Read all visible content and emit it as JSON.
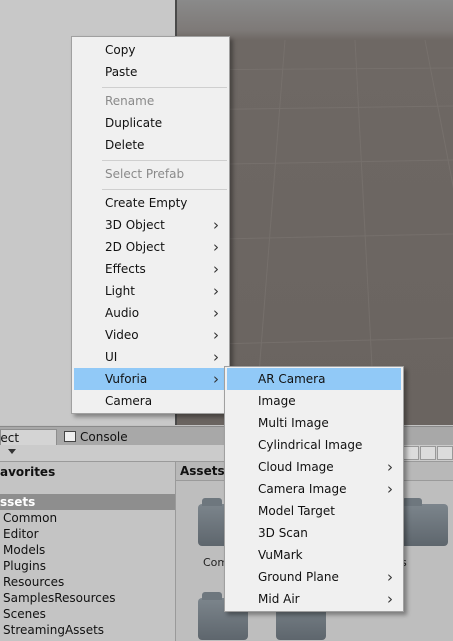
{
  "context_menu": {
    "items": [
      {
        "label": "Copy",
        "enabled": true,
        "submenu": false
      },
      {
        "label": "Paste",
        "enabled": true,
        "submenu": false
      },
      {
        "label": "Rename",
        "enabled": false,
        "submenu": false
      },
      {
        "label": "Duplicate",
        "enabled": true,
        "submenu": false
      },
      {
        "label": "Delete",
        "enabled": true,
        "submenu": false
      },
      {
        "label": "Select Prefab",
        "enabled": false,
        "submenu": false
      },
      {
        "label": "Create Empty",
        "enabled": true,
        "submenu": false
      },
      {
        "label": "3D Object",
        "enabled": true,
        "submenu": true
      },
      {
        "label": "2D Object",
        "enabled": true,
        "submenu": true
      },
      {
        "label": "Effects",
        "enabled": true,
        "submenu": true
      },
      {
        "label": "Light",
        "enabled": true,
        "submenu": true
      },
      {
        "label": "Audio",
        "enabled": true,
        "submenu": true
      },
      {
        "label": "Video",
        "enabled": true,
        "submenu": true
      },
      {
        "label": "UI",
        "enabled": true,
        "submenu": true
      },
      {
        "label": "Vuforia",
        "enabled": true,
        "submenu": true,
        "highlighted": true
      },
      {
        "label": "Camera",
        "enabled": true,
        "submenu": false
      }
    ]
  },
  "submenu": {
    "items": [
      {
        "label": "AR Camera",
        "submenu": false,
        "highlighted": true
      },
      {
        "label": "Image",
        "submenu": false
      },
      {
        "label": "Multi Image",
        "submenu": false
      },
      {
        "label": "Cylindrical Image",
        "submenu": false
      },
      {
        "label": "Cloud Image",
        "submenu": true
      },
      {
        "label": "Camera Image",
        "submenu": true
      },
      {
        "label": "Model Target",
        "submenu": false
      },
      {
        "label": "3D Scan",
        "submenu": false
      },
      {
        "label": "VuMark",
        "submenu": false
      },
      {
        "label": "Ground Plane",
        "submenu": true
      },
      {
        "label": "Mid Air",
        "submenu": true
      }
    ]
  },
  "tabs": {
    "project": "ject",
    "console": "Console"
  },
  "tree": {
    "favorites": "avorites",
    "assets": "ssets",
    "folders": [
      "Common",
      "Editor",
      "Models",
      "Plugins",
      "Resources",
      "SamplesResources",
      "Scenes",
      "StreamingAssets"
    ]
  },
  "assets_panel": {
    "header": "Assets",
    "label_left": "Com",
    "label_right": "s"
  },
  "colors": {
    "highlight": "#91c9f7",
    "menu_bg": "#f0f0f0",
    "scene": "#6a6460"
  }
}
